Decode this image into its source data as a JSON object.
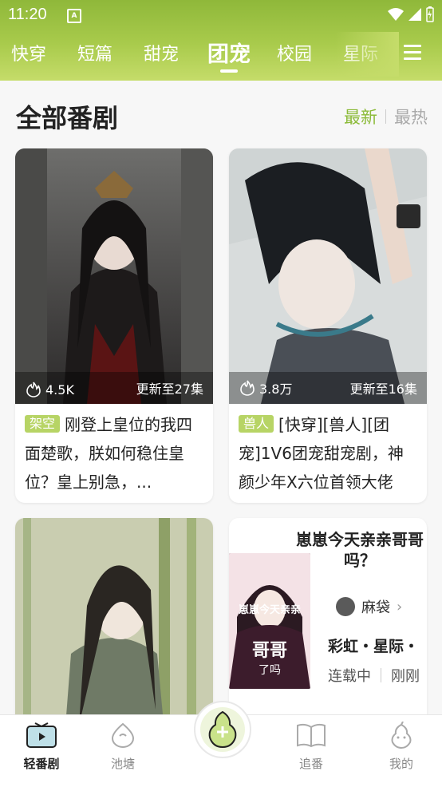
{
  "status": {
    "time": "11:20",
    "notification_icon": "A"
  },
  "tabs": [
    {
      "label": "快穿"
    },
    {
      "label": "短篇"
    },
    {
      "label": "甜宠"
    },
    {
      "label": "团宠"
    },
    {
      "label": "校园"
    },
    {
      "label": "星际"
    }
  ],
  "section": {
    "title": "全部番剧",
    "sort_latest": "最新",
    "sort_hottest": "最热"
  },
  "cards": [
    {
      "heat": "4.5K",
      "episodes": "更新至27集",
      "tag": "架空",
      "title": "刚登上皇位的我四面楚歌，朕如何稳住皇位？皇上别急，..."
    },
    {
      "heat": "3.8万",
      "episodes": "更新至16集",
      "tag": "兽人",
      "title": "[快穿][兽人][团宠]1V6团宠甜宠剧，神颜少年X六位首领大佬"
    },
    {
      "heat": "",
      "episodes": "",
      "tag": "",
      "title": ""
    },
    {
      "banner_title": "崽崽今天亲亲哥哥吗？",
      "cover_text_1": "崽崽今天亲亲",
      "cover_text_2": "哥哥",
      "cover_text_3": "了吗",
      "author": "麻袋",
      "genre": "彩虹・星际・",
      "status": "连载中",
      "update": "刚刚"
    }
  ],
  "bottom_nav": [
    {
      "label": "轻番剧"
    },
    {
      "label": "池塘"
    },
    {
      "label": "追番"
    },
    {
      "label": "我的"
    }
  ],
  "colors": {
    "accent": "#8cbb3a",
    "tag": "#b7d465",
    "header": "#a9cb4c"
  }
}
